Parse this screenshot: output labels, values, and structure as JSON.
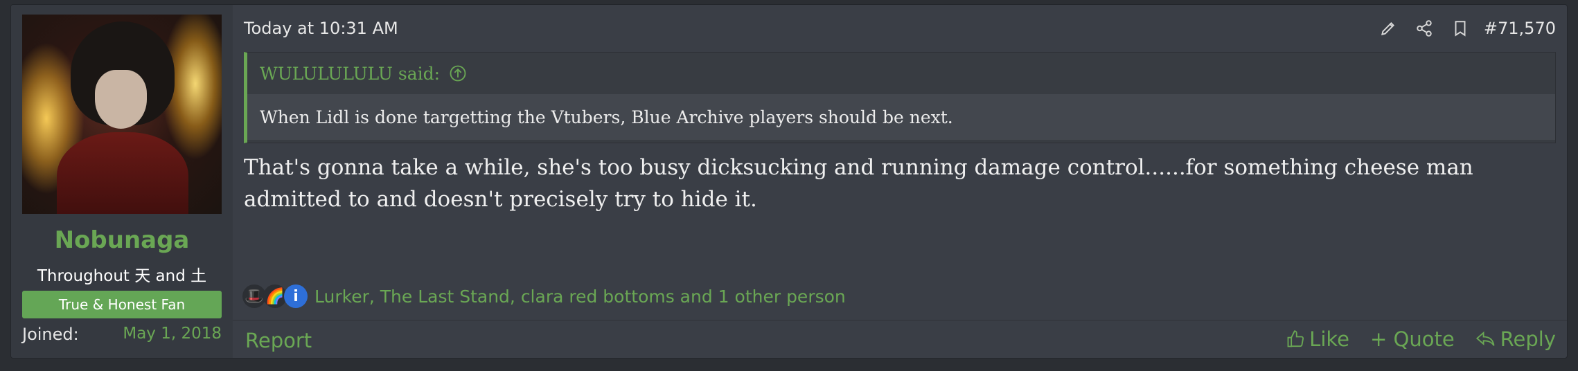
{
  "user": {
    "name": "Nobunaga",
    "title": "Throughout 天 and 土",
    "banner": "True & Honest Fan",
    "joined_label": "Joined:",
    "joined_value": "May 1, 2018"
  },
  "post": {
    "date": "Today at 10:31 AM",
    "number": "#71,570",
    "quote_author": "WULULULULU said:",
    "quote_text": "When Lidl is done targetting the Vtubers, Blue Archive players should be next.",
    "message": "That's gonna take a while, she's too busy dicksucking and running damage control......for something cheese man admitted to and doesn't precisely try to hide it.",
    "reaction_users": "Lurker, The Last Stand, clara red bottoms and 1 other person",
    "reactions": [
      "🎩",
      "🌈",
      "i"
    ]
  },
  "footer": {
    "report": "Report",
    "like": "Like",
    "quote": "+ Quote",
    "reply": "Reply"
  },
  "colors": {
    "accent": "#6aa754",
    "background": "#3a3e46"
  }
}
